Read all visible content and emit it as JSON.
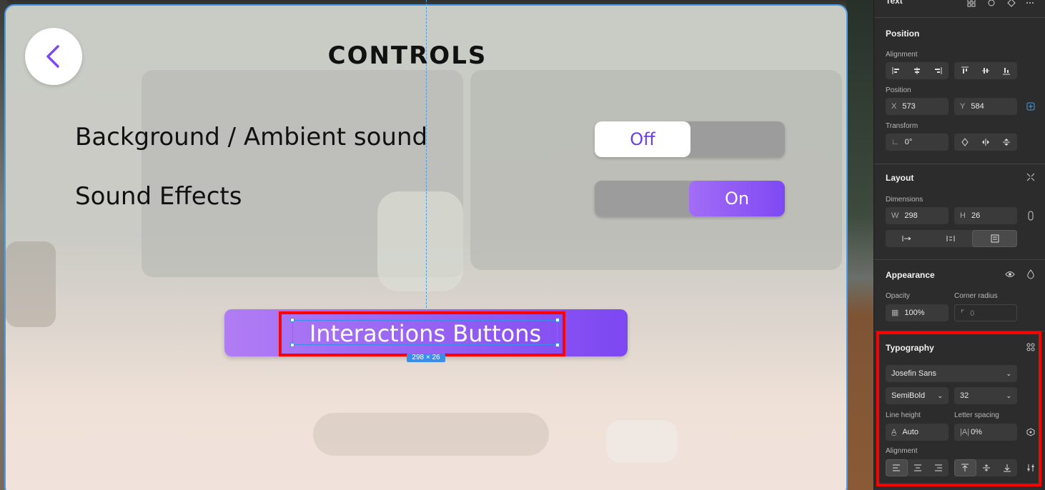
{
  "canvas": {
    "title": "CONTROLS",
    "settings": [
      {
        "label": "Background / Ambient sound",
        "state": "Off"
      },
      {
        "label": "Sound Effects",
        "state": "On"
      }
    ],
    "interactions_button_label": "Interactions Buttons",
    "selection_dimensions": "298 × 26",
    "colors": {
      "accent": "#7d47f2",
      "accent_light": "#b17df4",
      "selection": "#3b8ee8",
      "highlight": "#ff0000"
    }
  },
  "panel": {
    "layer_type": "Text",
    "position": {
      "title": "Position",
      "alignment_label": "Alignment",
      "position_label": "Position",
      "x_prefix": "X",
      "x": "573",
      "y_prefix": "Y",
      "y": "584",
      "transform_label": "Transform",
      "rotation": "0°"
    },
    "layout": {
      "title": "Layout",
      "dimensions_label": "Dimensions",
      "w_prefix": "W",
      "w": "298",
      "h_prefix": "H",
      "h": "26"
    },
    "appearance": {
      "title": "Appearance",
      "opacity_label": "Opacity",
      "opacity": "100%",
      "corner_radius_label": "Corner radius",
      "corner_radius": "0"
    },
    "typography": {
      "title": "Typography",
      "font_family": "Josefin Sans",
      "font_weight": "SemiBold",
      "font_size": "32",
      "line_height_label": "Line height",
      "line_height": "Auto",
      "letter_spacing_label": "Letter spacing",
      "letter_spacing": "0%",
      "alignment_label": "Alignment"
    }
  }
}
